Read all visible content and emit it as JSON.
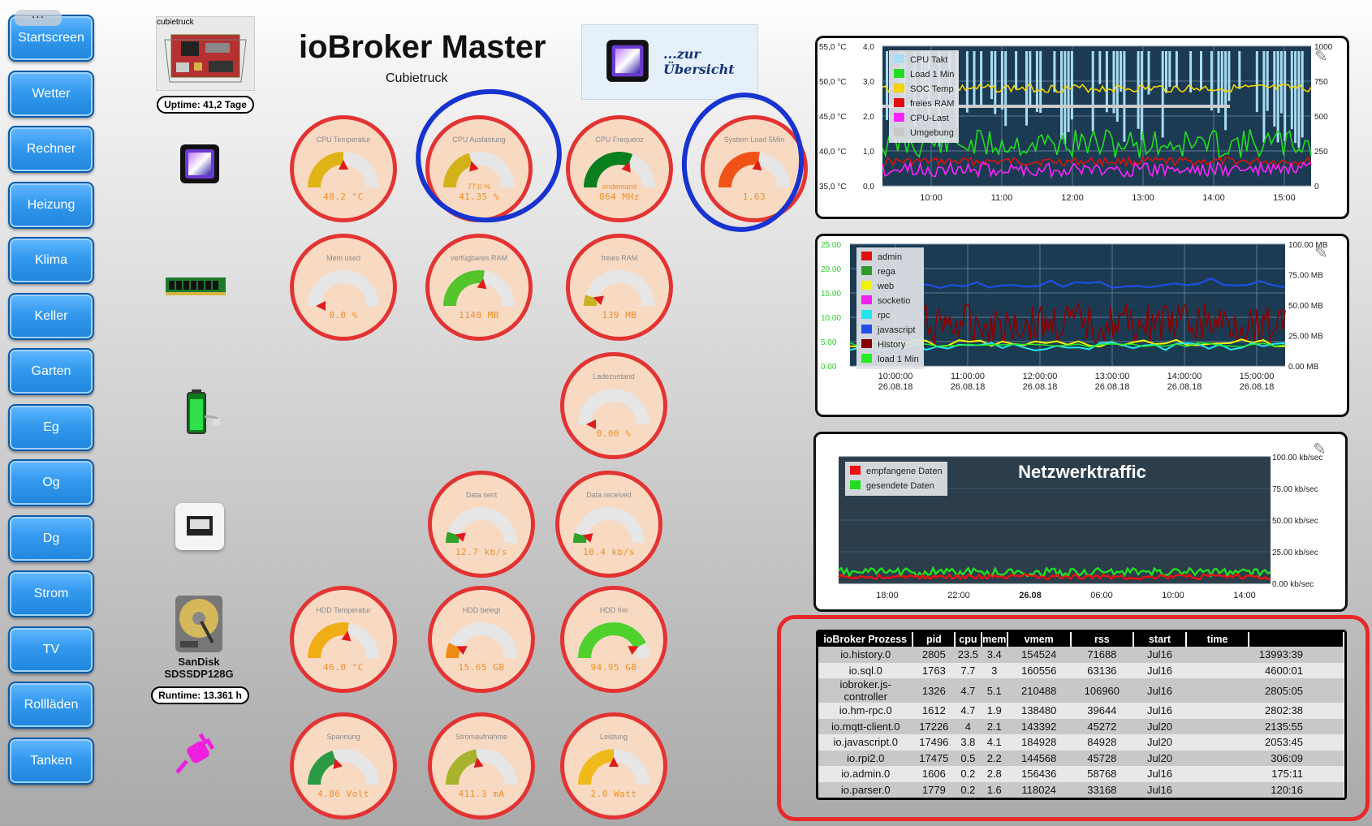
{
  "menu_dots": "...",
  "nav": [
    "Startscreen",
    "Wetter",
    "Rechner",
    "Heizung",
    "Klima",
    "Keller",
    "Garten",
    "Eg",
    "Og",
    "Dg",
    "Strom",
    "TV",
    "Rollläden",
    "Tanken"
  ],
  "header": {
    "title": "ioBroker Master",
    "subtitle": "Cubietruck",
    "overview_link": "...zur Übersicht"
  },
  "device": {
    "board_label": "cubietruck",
    "uptime": "Uptime: 41,2 Tage",
    "hdd_name": "SanDisk SDSSDP128G",
    "runtime": "Runtime: 13.361 h"
  },
  "gauges": [
    {
      "label": "CPU Temperatur",
      "value": "48.2 °C",
      "fill": 0.5,
      "color": "#e0b416"
    },
    {
      "label": "CPU Auslastung",
      "value": "41.35 %",
      "sub": "77.0 %",
      "fill": 0.41,
      "color": "#d3b218"
    },
    {
      "label": "CPU Frequenz",
      "value": "864 MHz",
      "sub": "ondemand",
      "fill": 0.62,
      "color": "#0a7f1d"
    },
    {
      "label": "System Load 5Min",
      "value": "1.63",
      "fill": 0.55,
      "color": "#f15316"
    },
    {
      "label": "Mem used",
      "value": "0.0 %",
      "fill": 0.0,
      "color": "#999"
    },
    {
      "label": "verfügbares RAM",
      "value": "1140 MB",
      "fill": 0.55,
      "color": "#54c32c"
    },
    {
      "label": "freies RAM",
      "value": "139 MB",
      "fill": 0.1,
      "color": "#c9b320"
    },
    {
      "label": "Ladezustand",
      "value": "0.00 %",
      "fill": 0.0,
      "color": "#999"
    },
    {
      "label": "Data sent",
      "value": "12.7 kb/s",
      "fill": 0.1,
      "color": "#2fa32a"
    },
    {
      "label": "Data received",
      "value": "10.4 kb/s",
      "fill": 0.09,
      "color": "#2fa32a"
    },
    {
      "label": "HDD Temperatur",
      "value": "46.0 °C",
      "fill": 0.55,
      "color": "#f0ad16"
    },
    {
      "label": "HDD belegt",
      "value": "15.65 GB",
      "fill": 0.14,
      "color": "#f08c14"
    },
    {
      "label": "HDD frei",
      "value": "94.95 GB",
      "fill": 0.86,
      "color": "#4fd12e"
    },
    {
      "label": "Spannung",
      "value": "4.86 Volt",
      "fill": 0.4,
      "color": "#2a9a45"
    },
    {
      "label": "Stromaufnahme",
      "value": "411.3 mA",
      "fill": 0.45,
      "color": "#a9b22c"
    },
    {
      "label": "Leistung",
      "value": "2.0 Watt",
      "fill": 0.5,
      "color": "#f0bb1a"
    }
  ],
  "chart_data": [
    {
      "type": "line",
      "series": [
        {
          "name": "CPU Takt"
        },
        {
          "name": "Load 1 Min"
        },
        {
          "name": "SOC Temp"
        },
        {
          "name": "freies RAM"
        },
        {
          "name": "CPU-Last"
        },
        {
          "name": "Umgebung"
        }
      ],
      "x_ticks": [
        "10:00",
        "11:00",
        "12:00",
        "13:00",
        "14:00",
        "15:00"
      ],
      "y_left_temp": [
        "55,0 °C",
        "50,0 °C",
        "45,0 °C",
        "40,0 °C",
        "35,0 °C"
      ],
      "y_left_load": [
        "4,0",
        "3,0",
        "2,0",
        "1,0",
        "0,0"
      ],
      "y_right": [
        "1000",
        "750",
        "500",
        "250",
        "0"
      ],
      "colors": [
        "#a8dcf4",
        "#22dd22",
        "#f2d200",
        "#e01010",
        "#ff22ff",
        "#c8c8c8"
      ]
    },
    {
      "type": "line",
      "series": [
        {
          "name": "admin"
        },
        {
          "name": "rega"
        },
        {
          "name": "web"
        },
        {
          "name": "socketio"
        },
        {
          "name": "rpc"
        },
        {
          "name": "javascript"
        },
        {
          "name": "History"
        },
        {
          "name": "load 1 Min"
        }
      ],
      "x_ticks": [
        "10:00:00\n26.08.18",
        "11:00:00\n26.08.18",
        "12:00:00\n26.08.18",
        "13:00:00\n26.08.18",
        "14:00:00\n26.08.18",
        "15:00:00\n26.08.18"
      ],
      "y_left": [
        "25.00",
        "20.00",
        "15.00",
        "10.00",
        "5.00",
        "0.00"
      ],
      "y_right": [
        "100.00 MB",
        "75.00 MB",
        "50.00 MB",
        "25.00 MB",
        "0.00 MB"
      ],
      "colors": [
        "#e01010",
        "#2c9a2c",
        "#f2f200",
        "#ee22ee",
        "#22e6ee",
        "#1f4fe6",
        "#8b0000",
        "#22ee22"
      ]
    },
    {
      "type": "area",
      "title": "Netzwerktraffic",
      "series": [
        {
          "name": "empfangene Daten"
        },
        {
          "name": "gesendete Daten"
        }
      ],
      "x_ticks": [
        "18:00",
        "22:00",
        "26.08",
        "06:00",
        "10:00",
        "14:00"
      ],
      "y_right": [
        "100.00 kb/sec",
        "75.00 kb/sec",
        "50.00 kb/sec",
        "25.00 kb/sec",
        "0.00 kb/sec"
      ],
      "colors": [
        "#ee1111",
        "#22dd22"
      ]
    }
  ],
  "process_table": {
    "headers": [
      "ioBroker Prozess",
      "pid",
      "cpu",
      "mem",
      "vmem",
      "rss",
      "start",
      "time",
      ""
    ],
    "rows": [
      [
        "io.history.0",
        "2805",
        "23.5",
        "3.4",
        "154524",
        "71688",
        "Jul16",
        "13993:39"
      ],
      [
        "io.sql.0",
        "1763",
        "7.7",
        "3",
        "160556",
        "63136",
        "Jul16",
        "4600:01"
      ],
      [
        "iobroker.js-controller",
        "1326",
        "4.7",
        "5.1",
        "210488",
        "106960",
        "Jul16",
        "2805:05"
      ],
      [
        "io.hm-rpc.0",
        "1612",
        "4.7",
        "1.9",
        "138480",
        "39644",
        "Jul16",
        "2802:38"
      ],
      [
        "io.mqtt-client.0",
        "17226",
        "4",
        "2.1",
        "143392",
        "45272",
        "Jul20",
        "2135:55"
      ],
      [
        "io.javascript.0",
        "17496",
        "3.8",
        "4.1",
        "184928",
        "84928",
        "Jul20",
        "2053:45"
      ],
      [
        "io.rpi2.0",
        "17475",
        "0.5",
        "2.2",
        "144568",
        "45728",
        "Jul20",
        "306:09"
      ],
      [
        "io.admin.0",
        "1606",
        "0.2",
        "2.8",
        "156436",
        "58768",
        "Jul16",
        "175:11"
      ],
      [
        "io.parser.0",
        "1779",
        "0.2",
        "1.6",
        "118024",
        "33168",
        "Jul16",
        "120:16"
      ]
    ]
  }
}
